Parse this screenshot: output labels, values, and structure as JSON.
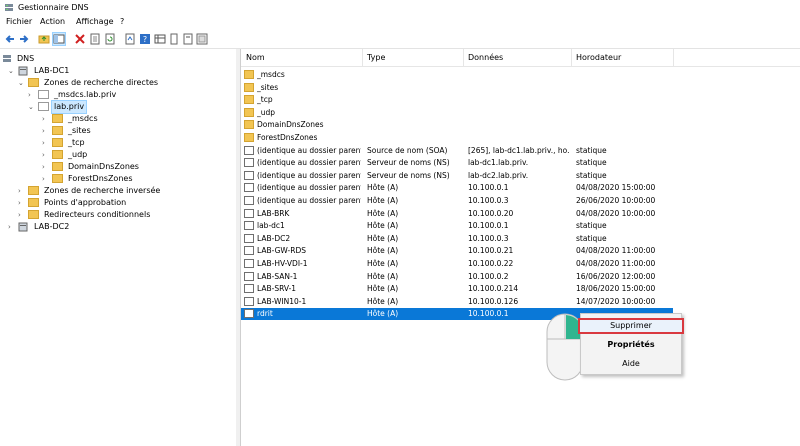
{
  "window": {
    "title": "Gestionnaire DNS"
  },
  "menu": {
    "items": [
      "Fichier",
      "Action",
      "Affichage",
      "?"
    ]
  },
  "toolbar": {
    "icons": [
      "back-icon",
      "forward-icon",
      "up-folder-icon",
      "console-tree-icon",
      "delete-icon",
      "properties-icon",
      "refresh-icon",
      "export-icon",
      "help-icon",
      "view-icon",
      "record-icon",
      "record-icon",
      "record-icon"
    ]
  },
  "tree": {
    "root": "DNS",
    "server1": "LAB-DC1",
    "forward_zones": "Zones de recherche directes",
    "msdcs_zone": "_msdcs.lab.priv",
    "lab_zone": "lab.priv",
    "lab_children": [
      "_msdcs",
      "_sites",
      "_tcp",
      "_udp",
      "DomainDnsZones",
      "ForestDnsZones"
    ],
    "reverse_zones": "Zones de recherche inversée",
    "trust_points": "Points d'approbation",
    "conditional_forwarders": "Redirecteurs conditionnels",
    "server2": "LAB-DC2"
  },
  "columns": {
    "name": "Nom",
    "type": "Type",
    "data": "Données",
    "timestamp": "Horodateur"
  },
  "folders": [
    "_msdcs",
    "_sites",
    "_tcp",
    "_udp",
    "DomainDnsZones",
    "ForestDnsZones"
  ],
  "records": [
    {
      "name": "(identique au dossier parent)",
      "type": "Source de nom (SOA)",
      "data": "[265], lab-dc1.lab.priv., ho...",
      "ts": "statique"
    },
    {
      "name": "(identique au dossier parent)",
      "type": "Serveur de noms (NS)",
      "data": "lab-dc1.lab.priv.",
      "ts": "statique"
    },
    {
      "name": "(identique au dossier parent)",
      "type": "Serveur de noms (NS)",
      "data": "lab-dc2.lab.priv.",
      "ts": "statique"
    },
    {
      "name": "(identique au dossier parent)",
      "type": "Hôte (A)",
      "data": "10.100.0.1",
      "ts": "04/08/2020 15:00:00"
    },
    {
      "name": "(identique au dossier parent)",
      "type": "Hôte (A)",
      "data": "10.100.0.3",
      "ts": "26/06/2020 10:00:00"
    },
    {
      "name": "LAB-BRK",
      "type": "Hôte (A)",
      "data": "10.100.0.20",
      "ts": "04/08/2020 10:00:00"
    },
    {
      "name": "lab-dc1",
      "type": "Hôte (A)",
      "data": "10.100.0.1",
      "ts": "statique"
    },
    {
      "name": "LAB-DC2",
      "type": "Hôte (A)",
      "data": "10.100.0.3",
      "ts": "statique"
    },
    {
      "name": "LAB-GW-RDS",
      "type": "Hôte (A)",
      "data": "10.100.0.21",
      "ts": "04/08/2020 11:00:00"
    },
    {
      "name": "LAB-HV-VDI-1",
      "type": "Hôte (A)",
      "data": "10.100.0.22",
      "ts": "04/08/2020 11:00:00"
    },
    {
      "name": "LAB-SAN-1",
      "type": "Hôte (A)",
      "data": "10.100.0.2",
      "ts": "16/06/2020 12:00:00"
    },
    {
      "name": "LAB-SRV-1",
      "type": "Hôte (A)",
      "data": "10.100.0.214",
      "ts": "18/06/2020 15:00:00"
    },
    {
      "name": "LAB-WIN10-1",
      "type": "Hôte (A)",
      "data": "10.100.0.126",
      "ts": "14/07/2020 10:00:00"
    },
    {
      "name": "rdrit",
      "type": "Hôte (A)",
      "data": "10.100.0.1",
      "ts": ""
    }
  ],
  "context_menu": {
    "delete": "Supprimer",
    "properties": "Propriétés",
    "help": "Aide"
  }
}
